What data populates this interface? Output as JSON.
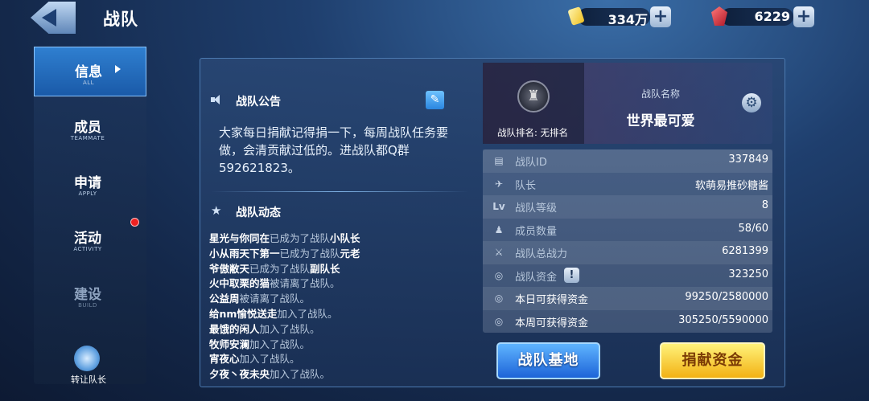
{
  "header": {
    "title": "战队",
    "gold_value": "334万",
    "gem_value": "6229",
    "plus_symbol": "+"
  },
  "sidebar": {
    "items": [
      {
        "label": "信息",
        "sub": "ALL",
        "state": "active"
      },
      {
        "label": "成员",
        "sub": "TEAMMATE",
        "state": "normal"
      },
      {
        "label": "申请",
        "sub": "APPLY",
        "state": "normal"
      },
      {
        "label": "活动",
        "sub": "ACTIVITY",
        "state": "normal"
      },
      {
        "label": "建设",
        "sub": "BUILD",
        "state": "disabled"
      }
    ],
    "transfer_label": "转让队长"
  },
  "announcement": {
    "heading": "战队公告",
    "text": "大家每日捐献记得捐一下，每周战队任务要做，会清贡献过低的。进战队都Q群592621823。"
  },
  "feed": {
    "heading": "战队动态",
    "lines": [
      {
        "name": "星光与你同在",
        "action": "已成为了战队",
        "role": "小队长"
      },
      {
        "name": "小从雨天下第一",
        "action": "已成为了战队",
        "role": "元老"
      },
      {
        "name": "爷傲敝天",
        "action": "已成为了战队",
        "role": "副队长"
      },
      {
        "name": "火中取栗的猫",
        "action": "被请离了战队。",
        "role": ""
      },
      {
        "name": "公益周",
        "action": "被请离了战队。",
        "role": ""
      },
      {
        "name": "给nm愉悦送走",
        "action": "加入了战队。",
        "role": ""
      },
      {
        "name": "最饿的闲人",
        "action": "加入了战队。",
        "role": ""
      },
      {
        "name": "牧师安澜",
        "action": "加入了战队。",
        "role": ""
      },
      {
        "name": "宵夜心",
        "action": "加入了战队。",
        "role": ""
      },
      {
        "name": "夕夜丶夜未央",
        "action": "加入了战队。",
        "role": ""
      }
    ]
  },
  "team": {
    "rank_label": "战队排名: 无排名",
    "name_label": "战队名称",
    "name": "世界最可爱"
  },
  "stats": [
    {
      "label": "战队ID",
      "value": "337849",
      "icon": "id-card-icon",
      "glyph": "▤"
    },
    {
      "label": "队长",
      "value": "软萌易推砂糖酱",
      "icon": "captain-wings-icon",
      "glyph": "✈"
    },
    {
      "label": "战队等级",
      "value": "8",
      "icon": "level-icon",
      "glyph": "Lv"
    },
    {
      "label": "成员数量",
      "value": "58/60",
      "icon": "members-icon",
      "glyph": "♟"
    },
    {
      "label": "战队总战力",
      "value": "6281399",
      "icon": "power-icon",
      "glyph": "⚔"
    },
    {
      "label": "战队资金",
      "value": "323250",
      "icon": "coins-icon",
      "glyph": "◎"
    },
    {
      "label": "本日可获得资金",
      "value": "99250/2580000",
      "icon": "coins-icon",
      "glyph": "◎"
    },
    {
      "label": "本周可获得资金",
      "value": "305250/5590000",
      "icon": "coins-icon",
      "glyph": "◎"
    }
  ],
  "buttons": {
    "base": "战队基地",
    "donate": "捐献资金"
  },
  "colors": {
    "accent_blue": "#2a86e0",
    "donate_yellow": "#f2b214",
    "notification_red": "#e22222"
  }
}
